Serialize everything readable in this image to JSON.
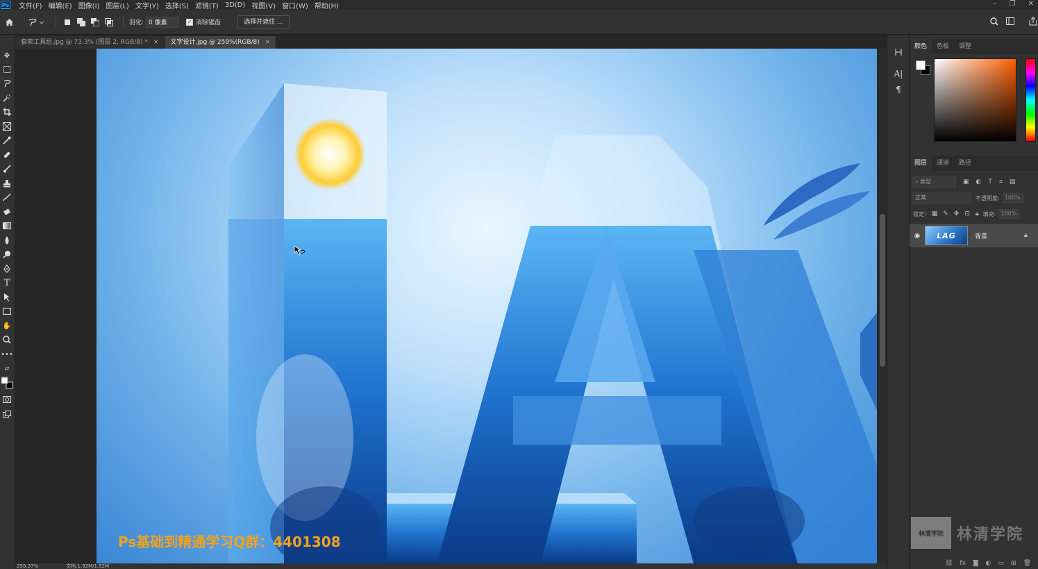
{
  "menu": {
    "app_logo": "Ps",
    "items": [
      "文件(F)",
      "编辑(E)",
      "图像(I)",
      "图层(L)",
      "文字(Y)",
      "选择(S)",
      "滤镜(T)",
      "3D(D)",
      "视图(V)",
      "窗口(W)",
      "帮助(H)"
    ],
    "window_controls": [
      "–",
      "❐",
      "✕"
    ]
  },
  "options": {
    "feather_label": "羽化:",
    "feather_value": "0 像素",
    "antialias_label": "消除锯齿",
    "antialias_checked": true,
    "select_mask_label": "选择并遮住 ..."
  },
  "tabs": [
    {
      "label": "套索工具组.jpg @ 73.3% (图层 2, RGB/8) *",
      "close": "×",
      "active": false
    },
    {
      "label": "文字设计.jpg @ 259%(RGB/8)",
      "close": "×",
      "active": true
    }
  ],
  "canvas": {
    "promo_text": "Ps基础到精通学习Q群：4401308",
    "colors": {
      "sky_top": "#eaf6ff",
      "sky_mid": "#6fb2ea",
      "sky_deep": "#3a86d4",
      "promo": "#f4a21c"
    }
  },
  "status": {
    "zoom": "259.37%",
    "doc_info": "文档:1.92M/1.92M"
  },
  "color_panel": {
    "tabs": [
      "颜色",
      "色板",
      "调整"
    ],
    "active_tab": "颜色",
    "foreground": "#ffffff",
    "background": "#000000",
    "hue": "#ff5e00"
  },
  "layers_panel": {
    "tabs": [
      "图层",
      "通道",
      "路径"
    ],
    "active_tab": "图层",
    "filter_placeholder": "类型",
    "blend_mode": "正常",
    "opacity_label": "不透明度:",
    "opacity_value": "100%",
    "lock_label": "锁定:",
    "fill_label": "填充:",
    "fill_value": "100%",
    "layers": [
      {
        "name": "背景",
        "thumb_text": "LAG",
        "visible": true,
        "locked": true
      }
    ],
    "footer_icons": [
      "link-icon",
      "fx-icon",
      "mask-icon",
      "adjustment-icon",
      "group-icon",
      "new-layer-icon",
      "trash-icon"
    ]
  },
  "watermark": {
    "seal_text": "林清学院",
    "brand": "林清学院"
  }
}
